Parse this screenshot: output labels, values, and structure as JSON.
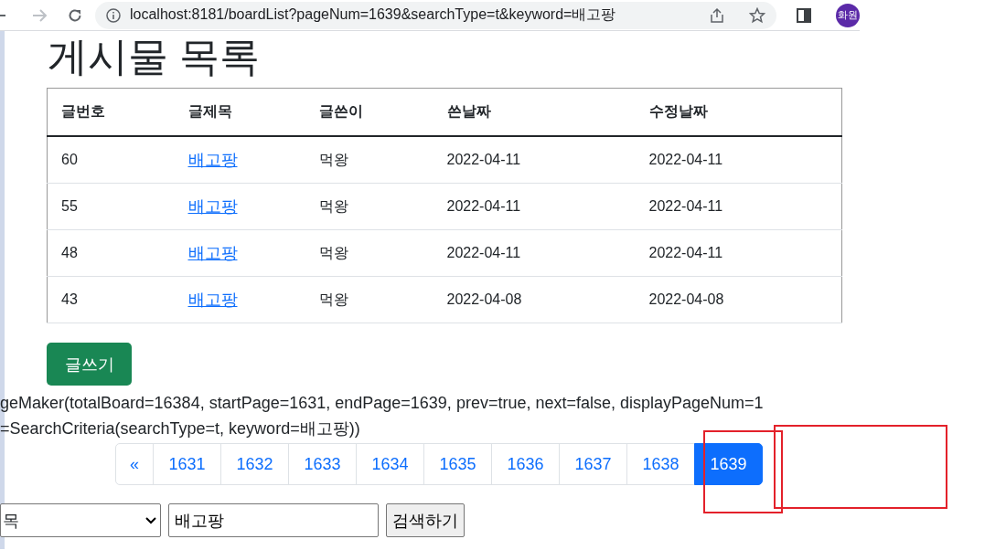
{
  "browser": {
    "url": "localhost:8181/boardList?pageNum=1639&searchType=t&keyword=배고팡",
    "profile": "화원"
  },
  "page": {
    "title": "게시물 목록",
    "table": {
      "columns": [
        "글번호",
        "글제목",
        "글쓴이",
        "쓴날짜",
        "수정날짜"
      ],
      "rows": [
        {
          "number": "60",
          "title": "배고팡",
          "writer": "먹왕",
          "created": "2022-04-11",
          "updated": "2022-04-11"
        },
        {
          "number": "55",
          "title": "배고팡",
          "writer": "먹왕",
          "created": "2022-04-11",
          "updated": "2022-04-11"
        },
        {
          "number": "48",
          "title": "배고팡",
          "writer": "먹왕",
          "created": "2022-04-11",
          "updated": "2022-04-11"
        },
        {
          "number": "43",
          "title": "배고팡",
          "writer": "먹왕",
          "created": "2022-04-08",
          "updated": "2022-04-08"
        }
      ]
    },
    "write_button": "글쓰기",
    "debug_lines": [
      "geMaker(totalBoard=16384, startPage=1631, endPage=1639, prev=true, next=false, displayPageNum=1",
      "=SearchCriteria(searchType=t, keyword=배고팡))"
    ],
    "pagination": [
      {
        "label": "«",
        "selected": false
      },
      {
        "label": "1631",
        "selected": false
      },
      {
        "label": "1632",
        "selected": false
      },
      {
        "label": "1633",
        "selected": false
      },
      {
        "label": "1634",
        "selected": false
      },
      {
        "label": "1635",
        "selected": false
      },
      {
        "label": "1636",
        "selected": false
      },
      {
        "label": "1637",
        "selected": false
      },
      {
        "label": "1638",
        "selected": false
      },
      {
        "label": "1639",
        "selected": true
      }
    ],
    "search": {
      "type": "목",
      "keyword": "배고팡",
      "button": "검색하기"
    }
  }
}
